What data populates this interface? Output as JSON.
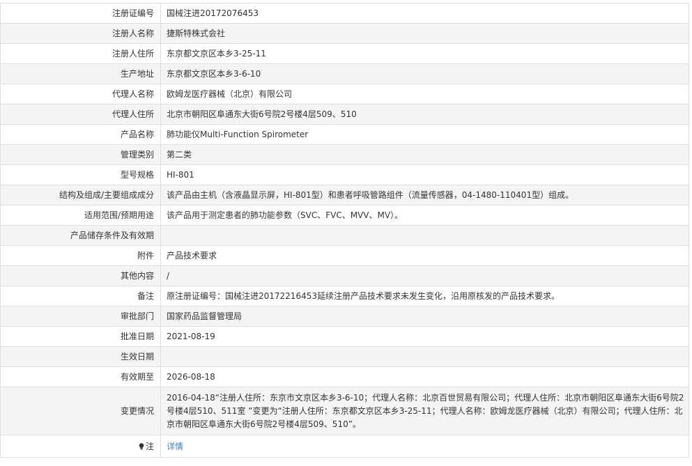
{
  "rows": [
    {
      "label": "注册证编号",
      "value": "国械注进20172076453"
    },
    {
      "label": "注册人名称",
      "value": "捷斯特株式会社"
    },
    {
      "label": "注册人住所",
      "value": "东京都文京区本乡3-25-11"
    },
    {
      "label": "生产地址",
      "value": "东京都文京区本乡3-6-10"
    },
    {
      "label": "代理人名称",
      "value": "欧姆龙医疗器械（北京）有限公司"
    },
    {
      "label": "代理人住所",
      "value": "北京市朝阳区阜通东大街6号院2号楼4层509、510"
    },
    {
      "label": "产品名称",
      "value": "肺功能仪Multi-Function Spirometer"
    },
    {
      "label": "管理类别",
      "value": "第二类"
    },
    {
      "label": "型号规格",
      "value": "HI-801"
    },
    {
      "label": "结构及组成/主要组成成分",
      "value": "该产品由主机（含液晶显示屏，HI-801型）和患者呼吸管路组件（流量传感器，04-1480-110401型）组成。"
    },
    {
      "label": "适用范围/预期用途",
      "value": "该产品用于测定患者的肺功能参数（SVC、FVC、MVV、MV）。"
    },
    {
      "label": "产品储存条件及有效期",
      "value": ""
    },
    {
      "label": "附件",
      "value": "产品技术要求"
    },
    {
      "label": "其他内容",
      "value": "/"
    },
    {
      "label": "备注",
      "value": "原注册证编号：国械注进20172216453延续注册产品技术要求未发生变化，沿用原核发的产品技术要求。"
    },
    {
      "label": "审批部门",
      "value": "国家药品监督管理局"
    },
    {
      "label": "批准日期",
      "value": "2021-08-19"
    },
    {
      "label": "生效日期",
      "value": ""
    },
    {
      "label": "有效期至",
      "value": "2026-08-18"
    },
    {
      "label": "变更情况",
      "value": "2016-04-18“注册人住所：东京市文京区本乡3-6-10；代理人名称：北京百世贸易有限公司；代理人住所：北京市朝阳区阜通东大街6号院2号楼4层510、511室 ”变更为“注册人住所：东京都文京区本乡3-25-11；代理人名称：欧姆龙医疗器械（北京）有限公司；代理人住所：北京市朝阳区阜通东大街6号院2号楼4层509、510”。"
    }
  ],
  "note_row": {
    "icon": "bulb-icon",
    "label": "注",
    "link_text": "详情"
  },
  "colors": {
    "border": "#dfdfdf",
    "stripe": "#f4f4f4",
    "text": "#333333",
    "link": "#3a83c4"
  }
}
